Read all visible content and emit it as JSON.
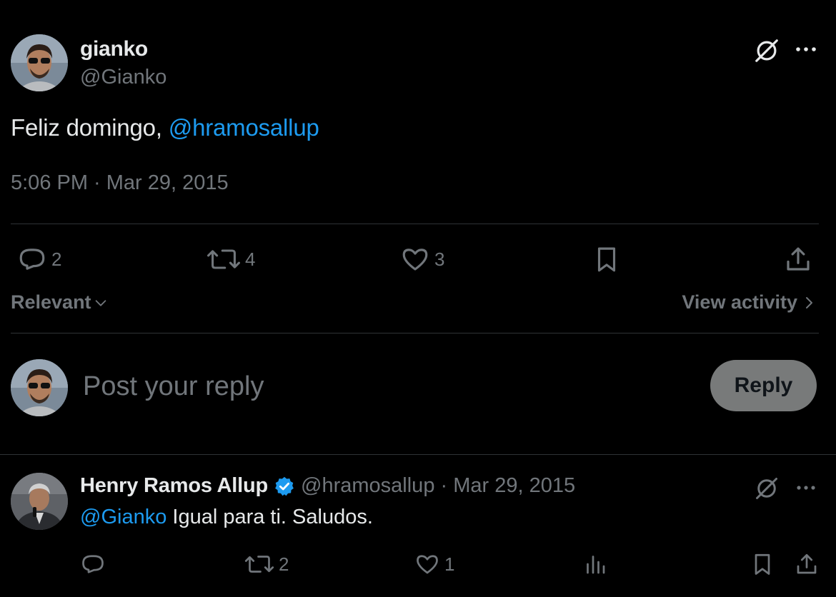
{
  "tweet": {
    "author_name": "gianko",
    "author_handle": "@Gianko",
    "text_prefix": "Feliz domingo, ",
    "text_mention": "@hramosallup",
    "timestamp": "5:06 PM · Mar 29, 2015",
    "stats": {
      "replies": "2",
      "reposts": "4",
      "likes": "3"
    }
  },
  "sort": {
    "label": "Relevant",
    "view_activity_label": "View activity"
  },
  "composer": {
    "placeholder": "Post your reply",
    "reply_button_label": "Reply"
  },
  "reply": {
    "author_name": "Henry Ramos Allup",
    "meta": "@hramosallup · Mar 29, 2015",
    "text_mention": "@Gianko",
    "text_body": " Igual para ti. Saludos.",
    "stats": {
      "reposts": "2",
      "likes": "1"
    }
  },
  "colors": {
    "background": "#000000",
    "text": "#e7e9ea",
    "muted": "#71767b",
    "accent": "#1d9bf0",
    "divider": "#2f3336",
    "reply_button_bg": "#787a7a"
  },
  "icons": {
    "grok": "grok-icon",
    "more": "more-icon",
    "reply": "reply-icon",
    "repost": "repost-icon",
    "like": "heart-icon",
    "bookmark": "bookmark-icon",
    "share": "share-icon",
    "analytics": "analytics-icon",
    "verified": "verified-badge-icon"
  }
}
